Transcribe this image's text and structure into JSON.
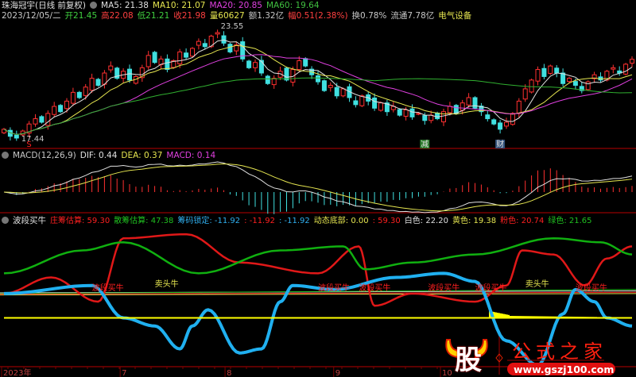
{
  "header": {
    "title": "珠海冠宇(日线 前复权)",
    "ma": [
      {
        "label": "MA5: 21.38",
        "color": "#e0e0e0"
      },
      {
        "label": "MA10: 21.07",
        "color": "#e6e650"
      },
      {
        "label": "MA20: 20.85",
        "color": "#e040e0"
      },
      {
        "label": "MA60: 19.64",
        "color": "#40c040"
      }
    ],
    "quote": [
      {
        "label": "2023/12/05/二",
        "color": "#c8c8c8"
      },
      {
        "label": "开21.45",
        "color": "#40d040"
      },
      {
        "label": "高22.08",
        "color": "#ff4040"
      },
      {
        "label": "低21.21",
        "color": "#40d040"
      },
      {
        "label": "收21.98",
        "color": "#ff4040"
      },
      {
        "label": "量60627",
        "color": "#e6e650"
      },
      {
        "label": "额1.32亿",
        "color": "#c8c8c8"
      },
      {
        "label": "幅0.51(2.38%)",
        "color": "#ff4040"
      },
      {
        "label": "换0.78%",
        "color": "#c8c8c8"
      },
      {
        "label": "流通7.78亿",
        "color": "#c8c8c8"
      },
      {
        "label": "电气设备",
        "color": "#e6e650"
      }
    ]
  },
  "macd_header": {
    "name": "MACD(12,26,9)",
    "items": [
      {
        "label": "DIF: 0.44",
        "color": "#e0e0e0"
      },
      {
        "label": "DEA: 0.37",
        "color": "#e6e650"
      },
      {
        "label": "MACD: 0.14",
        "color": "#e040e0"
      }
    ]
  },
  "ind_header": {
    "name": "波段买牛",
    "items": [
      {
        "label": "庄筹估算: 59.30",
        "color": "#ff2020"
      },
      {
        "label": "散筹估算: 47.38",
        "color": "#20c020"
      },
      {
        "label": "筹码锁定: -11.92",
        "color": "#30b0f0"
      },
      {
        "label": ": -11.92",
        "color": "#ff2020"
      },
      {
        "label": ": -11.92",
        "color": "#30b0f0"
      },
      {
        "label": "动态底部: 0.00",
        "color": "#e6e650"
      },
      {
        "label": ": 59.30",
        "color": "#ff2020"
      },
      {
        "label": "白色: 22.20",
        "color": "#e0e0e0"
      },
      {
        "label": "黄色: 19.38",
        "color": "#e6e650"
      },
      {
        "label": "粉色: 20.74",
        "color": "#ff2020"
      },
      {
        "label": "绿色: 21.65",
        "color": "#20c020"
      }
    ]
  },
  "colors": {
    "up": "#ff3030",
    "down": "#40e0e0",
    "divider": "#7a0000",
    "ma5": "#e0e0e0",
    "ma10": "#e6e650",
    "ma20": "#e040e0",
    "ma60": "#30b030",
    "red": "#e01818",
    "green": "#10b010",
    "blue": "#20b0f0",
    "yellow": "#ffff00"
  },
  "chart_data": [
    {
      "type": "candlestick",
      "title": "珠海冠宇(日线 前复权)",
      "close": [
        18.0,
        17.6,
        17.5,
        17.9,
        18.3,
        18.6,
        18.4,
        18.9,
        19.3,
        19.0,
        19.6,
        20.1,
        19.8,
        20.4,
        20.9,
        20.5,
        21.2,
        21.6,
        20.9,
        21.3,
        20.8,
        21.0,
        21.5,
        22.2,
        21.8,
        22.0,
        21.4,
        21.9,
        22.4,
        22.1,
        22.6,
        23.0,
        22.7,
        23.3,
        23.5,
        22.9,
        22.4,
        22.8,
        22.0,
        21.5,
        21.8,
        21.2,
        20.6,
        20.9,
        21.3,
        20.8,
        21.4,
        21.9,
        21.6,
        21.1,
        20.7,
        20.2,
        20.5,
        19.9,
        20.3,
        19.8,
        19.4,
        19.9,
        19.6,
        19.2,
        19.5,
        19.0,
        19.3,
        18.8,
        19.1,
        18.7,
        18.9,
        18.5,
        18.8,
        18.6,
        19.0,
        19.3,
        18.9,
        19.5,
        19.8,
        19.2,
        19.0,
        18.6,
        18.3,
        18.0,
        18.4,
        18.9,
        19.6,
        20.3,
        20.8,
        21.4,
        21.0,
        21.6,
        21.2,
        20.6,
        20.9,
        20.5,
        20.2,
        20.7,
        21.1,
        20.8,
        21.3,
        21.5,
        21.2,
        21.7,
        21.98
      ],
      "ylim": [
        17.0,
        24.0
      ],
      "annotations": [
        {
          "index": 34,
          "text": "23.55"
        },
        {
          "index": 2,
          "text": "17.44"
        }
      ],
      "markers": [
        {
          "index": 4,
          "text": "S",
          "color": "#ff2020",
          "bg": "none"
        },
        {
          "index": 67,
          "text": "减",
          "color": "#e0e0e0",
          "bg": "#2a7a2a"
        },
        {
          "index": 79,
          "text": "财",
          "color": "#e0e0e0",
          "bg": "#30507a"
        }
      ],
      "ma_periods": [
        5,
        10,
        20,
        60
      ]
    },
    {
      "type": "macd",
      "params": [
        12,
        26,
        9
      ]
    },
    {
      "type": "line",
      "ylim": [
        0,
        100
      ],
      "x_index": [
        0,
        7.5,
        15,
        19,
        29,
        37.5,
        50,
        56.5,
        59,
        65,
        75,
        80,
        82.5,
        87.5,
        92.5,
        96,
        100
      ],
      "series": [
        {
          "name": "庄筹估算",
          "color": "#e01818",
          "x": [
            0,
            7.5,
            15,
            19,
            29,
            37.5,
            50,
            56.5,
            59,
            65,
            75,
            80,
            82.5,
            87.5,
            92.5,
            96,
            100
          ],
          "values": [
            53,
            65,
            47,
            94,
            97,
            76,
            68,
            88,
            44,
            53,
            47,
            59,
            85,
            82,
            59,
            79,
            88
          ]
        },
        {
          "name": "散筹估算",
          "color": "#10b010",
          "x": [
            0,
            12.5,
            19,
            31,
            44,
            54,
            57.5,
            65,
            75,
            87.5,
            95,
            100
          ],
          "values": [
            68,
            85,
            91,
            68,
            85,
            88,
            71,
            76,
            82,
            94,
            91,
            82
          ]
        },
        {
          "name": "筹码锁定",
          "color": "#20b0f0",
          "x": [
            0,
            14,
            19,
            24,
            28,
            30,
            32.5,
            37.5,
            41,
            44,
            46,
            52.5,
            62.5,
            70,
            75,
            80,
            85,
            89,
            91,
            94,
            96,
            100
          ],
          "values": [
            53,
            59,
            35,
            29,
            12,
            29,
            41,
            9,
            12,
            47,
            59,
            56,
            65,
            68,
            62,
            18,
            0,
            38,
            56,
            47,
            35,
            29
          ]
        },
        {
          "name": "动态底部",
          "color": "#ffff00",
          "x": [
            0,
            100
          ],
          "values": [
            35,
            35
          ]
        }
      ],
      "signals": [
        {
          "index": 14,
          "text": "波段买牛",
          "color": "#ff2020"
        },
        {
          "index": 24,
          "text": "卖头牛",
          "color": "#e6e650"
        },
        {
          "index": 50,
          "text": "波段买牛",
          "color": "#ff2020"
        },
        {
          "index": 56.5,
          "text": "波段买牛",
          "color": "#ff2020"
        },
        {
          "index": 67.5,
          "text": "波段买牛",
          "color": "#ff2020"
        },
        {
          "index": 75,
          "text": "波段买牛",
          "color": "#ff2020"
        },
        {
          "index": 83,
          "text": "卖头牛",
          "color": "#e6e650"
        },
        {
          "index": 91,
          "text": "波段买牛",
          "color": "#ff2020"
        }
      ]
    }
  ],
  "x_axis": [
    {
      "index": 0,
      "label": "2023年"
    },
    {
      "index": 18.5,
      "label": "7"
    },
    {
      "index": 35.2,
      "label": "8"
    },
    {
      "index": 52.5,
      "label": "9"
    },
    {
      "index": 69.5,
      "label": "10"
    }
  ],
  "logo": {
    "char": "股",
    "name": "公式之家",
    "url": "www.gszj100.com"
  }
}
